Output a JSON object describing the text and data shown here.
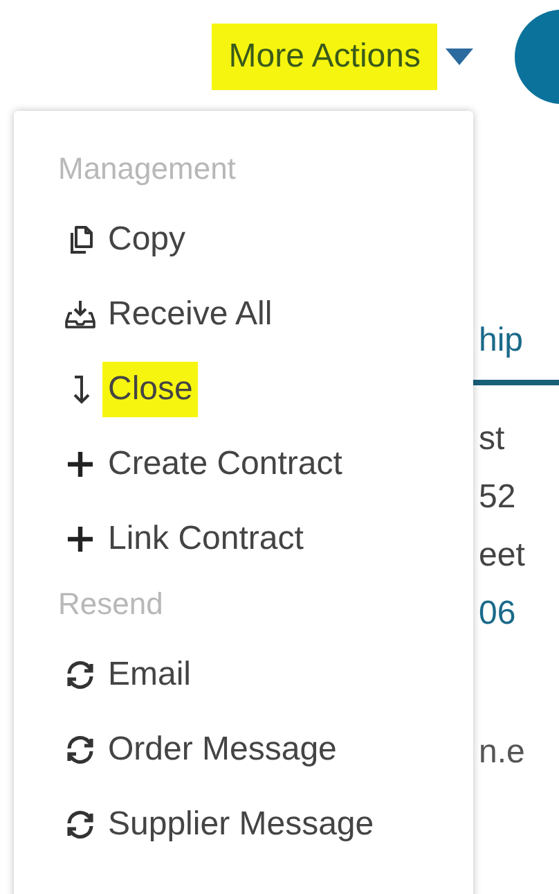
{
  "toolbar": {
    "more_actions": {
      "label": "More Actions",
      "highlighted": true
    }
  },
  "background": {
    "tab": "hip",
    "lines": [
      "st",
      "52",
      "eet",
      "06"
    ],
    "email": "n.e"
  },
  "menu": [
    {
      "kind": "header",
      "label": "Management"
    },
    {
      "kind": "copy",
      "label": "Copy",
      "highlighted": false
    },
    {
      "kind": "receive",
      "label": "Receive All",
      "highlighted": false
    },
    {
      "kind": "close",
      "label": "Close",
      "highlighted": true
    },
    {
      "kind": "plus",
      "label": "Create Contract",
      "highlighted": false
    },
    {
      "kind": "plus",
      "label": "Link Contract",
      "highlighted": false
    },
    {
      "kind": "header",
      "label": "Resend"
    },
    {
      "kind": "refresh",
      "label": "Email",
      "highlighted": false
    },
    {
      "kind": "refresh",
      "label": "Order Message",
      "highlighted": false
    },
    {
      "kind": "refresh",
      "label": "Supplier Message",
      "highlighted": false
    }
  ]
}
